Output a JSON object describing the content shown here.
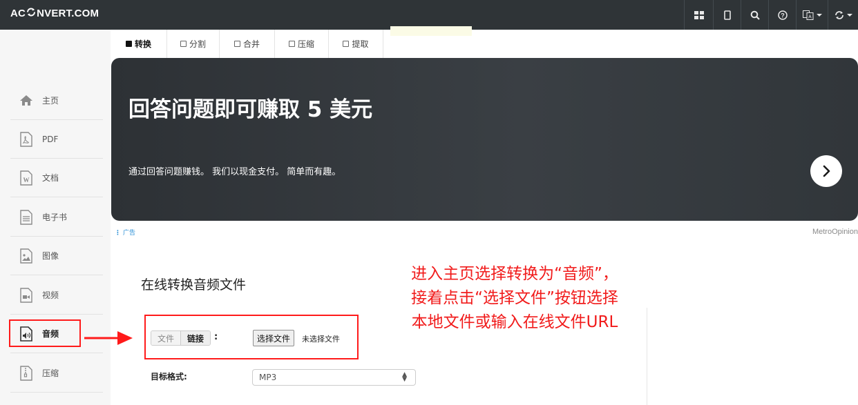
{
  "header": {
    "logo": {
      "left": "AC",
      "right": "NVERT.COM"
    },
    "nav_icons": [
      "grid-icon",
      "tablet-icon",
      "search-icon",
      "help-icon",
      "language-icon",
      "sync-icon"
    ]
  },
  "sidebar": {
    "items": [
      {
        "label": "主页",
        "icon": "home-icon"
      },
      {
        "label": "PDF",
        "icon": "pdf-file-icon"
      },
      {
        "label": "文档",
        "icon": "word-file-icon"
      },
      {
        "label": "电子书",
        "icon": "ebook-file-icon"
      },
      {
        "label": "图像",
        "icon": "image-file-icon"
      },
      {
        "label": "视频",
        "icon": "video-file-icon"
      },
      {
        "label": "音频",
        "icon": "audio-file-icon",
        "active": true
      },
      {
        "label": "压缩",
        "icon": "archive-file-icon"
      }
    ]
  },
  "tabs": [
    {
      "label": "转换",
      "active": true
    },
    {
      "label": "分割"
    },
    {
      "label": "合并"
    },
    {
      "label": "压缩"
    },
    {
      "label": "提取"
    }
  ],
  "banner": {
    "title": "回答问题即可赚取 5 美元",
    "subtitle": "通过回答问题赚钱。 我们以现金支付。 简单而有趣。",
    "ad_label": "广告",
    "brand": "MetroOpinion"
  },
  "main": {
    "title": "在线转换音频文件",
    "annotation": [
      "进入主页选择转换为“音频”，",
      "接着点击“选择文件”按钮选择",
      "本地文件或输入在线文件URL"
    ],
    "source_tabs": {
      "file": "文件",
      "link": "链接",
      "colon": ":"
    },
    "choose_file_button": "选择文件",
    "no_file_text": "未选择文件",
    "target_format_label": "目标格式:",
    "target_format_value": "MP3"
  },
  "colors": {
    "topbar": "#2f3437",
    "annotation_red": "#f11b1b",
    "banner_bg": "#33383c",
    "ad_blue": "#2a8fd6"
  }
}
